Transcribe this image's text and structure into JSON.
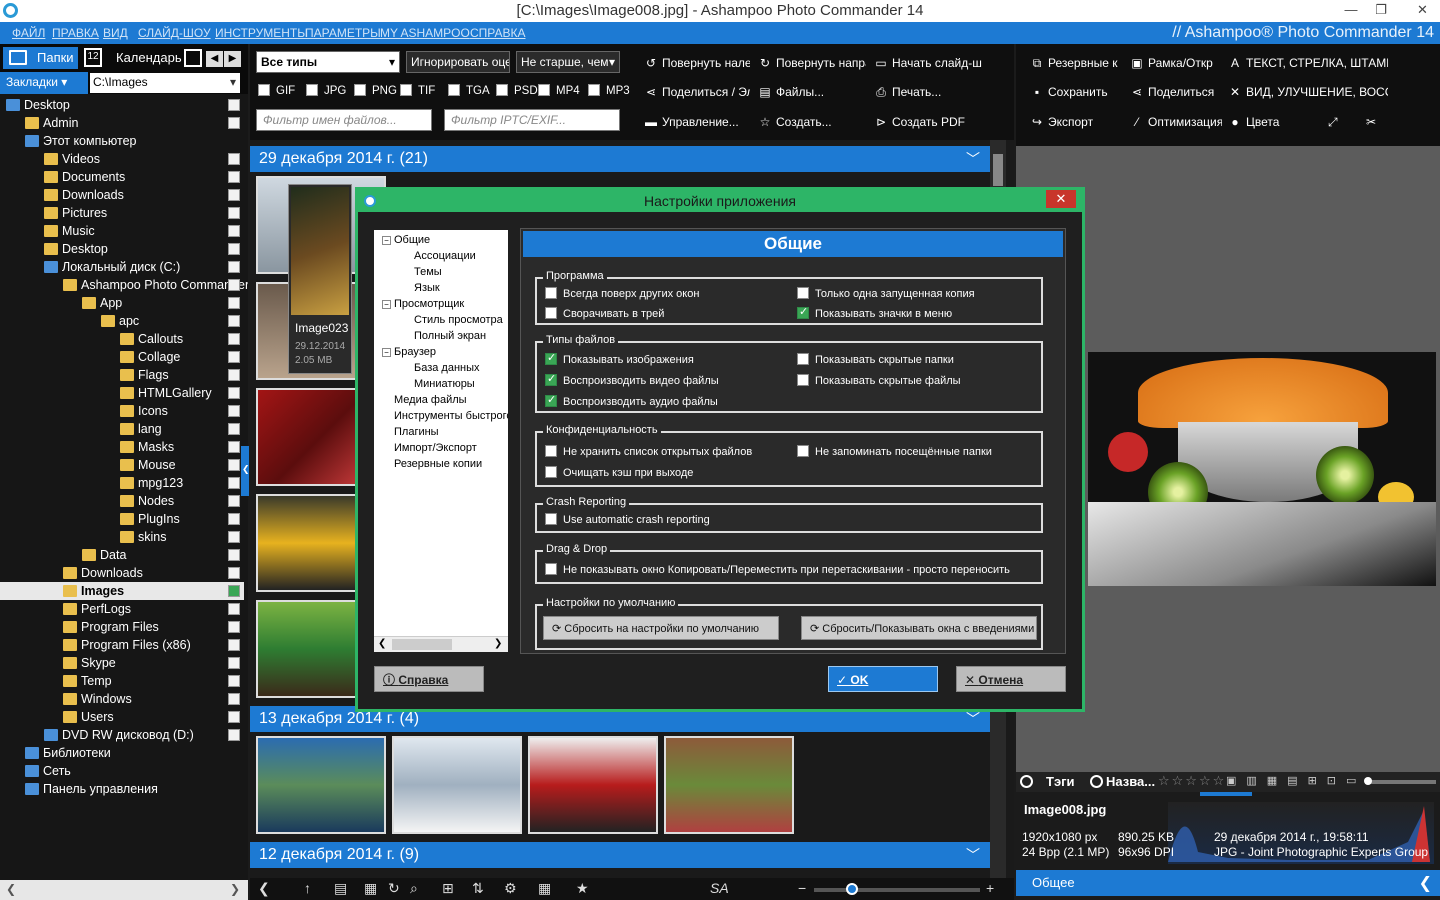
{
  "window": {
    "title": "[C:\\Images\\Image008.jpg] - Ashampoo Photo Commander 14"
  },
  "menu": [
    "ФАЙЛ",
    "ПРАВКА",
    "ВИД",
    "СЛАЙД-ШОУ",
    "ИНСТРУМЕНТЫ",
    "ПАРАМЕТРЫ",
    "MY ASHAMPOO",
    "СПРАВКА"
  ],
  "brand": "// Ashampoo® Photo Commander 14",
  "left": {
    "tabs": {
      "folders": "Папки",
      "calendar": "Календарь"
    },
    "bookmarks": "Закладки",
    "path": "C:\\Images",
    "tree": [
      {
        "label": "Desktop",
        "indent": 0
      },
      {
        "label": "Admin",
        "indent": 1
      },
      {
        "label": "Этот компьютер",
        "indent": 1
      },
      {
        "label": "Videos",
        "indent": 2
      },
      {
        "label": "Documents",
        "indent": 2
      },
      {
        "label": "Downloads",
        "indent": 2
      },
      {
        "label": "Pictures",
        "indent": 2
      },
      {
        "label": "Music",
        "indent": 2
      },
      {
        "label": "Desktop",
        "indent": 2
      },
      {
        "label": "Локальный диск (C:)",
        "indent": 2
      },
      {
        "label": "Ashampoo Photo Commander 14",
        "indent": 3
      },
      {
        "label": "App",
        "indent": 4
      },
      {
        "label": "apc",
        "indent": 5
      },
      {
        "label": "Callouts",
        "indent": 6
      },
      {
        "label": "Collage",
        "indent": 6
      },
      {
        "label": "Flags",
        "indent": 6
      },
      {
        "label": "HTMLGallery",
        "indent": 6
      },
      {
        "label": "Icons",
        "indent": 6
      },
      {
        "label": "lang",
        "indent": 6
      },
      {
        "label": "Masks",
        "indent": 6
      },
      {
        "label": "Mouse",
        "indent": 6
      },
      {
        "label": "mpg123",
        "indent": 6
      },
      {
        "label": "Nodes",
        "indent": 6
      },
      {
        "label": "PlugIns",
        "indent": 6
      },
      {
        "label": "skins",
        "indent": 6
      },
      {
        "label": "Data",
        "indent": 4
      },
      {
        "label": "Downloads",
        "indent": 3
      },
      {
        "label": "Images",
        "indent": 3,
        "selected": true
      },
      {
        "label": "PerfLogs",
        "indent": 3
      },
      {
        "label": "Program Files",
        "indent": 3
      },
      {
        "label": "Program Files (x86)",
        "indent": 3
      },
      {
        "label": "Skype",
        "indent": 3
      },
      {
        "label": "Temp",
        "indent": 3
      },
      {
        "label": "Windows",
        "indent": 3
      },
      {
        "label": "Users",
        "indent": 3
      },
      {
        "label": "DVD RW дисковод (D:)",
        "indent": 2
      },
      {
        "label": "Библиотеки",
        "indent": 1
      },
      {
        "label": "Сеть",
        "indent": 1
      },
      {
        "label": "Панель управления",
        "indent": 1
      }
    ]
  },
  "toolbar": {
    "type_filter": "Все типы",
    "ignore_rating": "Игнорировать оцен",
    "age_filter": "Не старше, чем",
    "filetypes": [
      "GIF",
      "JPG",
      "PNG",
      "TIF",
      "TGA",
      "PSD",
      "MP4",
      "MP3"
    ],
    "filename_filter_placeholder": "Фильтр имен файлов...",
    "iptc_filter_placeholder": "Фильтр IPTC/EXIF...",
    "buttons": {
      "rotate_left": "Повернуть нале",
      "rotate_right": "Повернуть напра",
      "slideshow": "Начать слайд-шо",
      "share": "Поделиться / Эл",
      "files": "Файлы...",
      "print": "Печать...",
      "manage": "Управление...",
      "create": "Создать...",
      "create_pdf": "Создать PDF"
    }
  },
  "groups": [
    {
      "label": "29 декабря 2014 г. (21)"
    },
    {
      "label": "13 декабря 2014 г. (4)"
    },
    {
      "label": "12 декабря 2014 г. (9)"
    }
  ],
  "tooltip": {
    "name": "Image023",
    "date": "29.12.2014",
    "size": "2.05 MB"
  },
  "right": {
    "buttons": {
      "backup": "Резервные к",
      "frame": "Рамка/Откр",
      "text": "ТЕКСТ, СТРЕЛКА, ШТАМП,",
      "save": "Сохранить",
      "share": "Поделиться",
      "view": "ВИД, УЛУЧШЕНИЕ, ВОССТ",
      "export": "Экспорт",
      "optimize": "Оптимизация",
      "colors": "Цвета"
    },
    "tabs": {
      "tags": "Тэги",
      "name": "Назва..."
    },
    "info": {
      "filename": "Image008.jpg",
      "dimensions": "1920x1080 px",
      "filesize": "890.25 KB",
      "datetime": "29 декабря 2014 г., 19:58:11",
      "depth": "24 Bpp (2.1 MP)",
      "dpi": "96x96 DPI",
      "format": "JPG - Joint Photographic Experts Group"
    },
    "footer": "Общее"
  },
  "dialog": {
    "title": "Настройки приложения",
    "nav": [
      {
        "label": "Общие",
        "level": 0,
        "exp": "−"
      },
      {
        "label": "Ассоциации",
        "level": 1
      },
      {
        "label": "Темы",
        "level": 1
      },
      {
        "label": "Язык",
        "level": 1
      },
      {
        "label": "Просмотрщик",
        "level": 0,
        "exp": "−"
      },
      {
        "label": "Стиль просмотра",
        "level": 1
      },
      {
        "label": "Полный экран",
        "level": 1
      },
      {
        "label": "Браузер",
        "level": 0,
        "exp": "−"
      },
      {
        "label": "База данных",
        "level": 1
      },
      {
        "label": "Миниатюры",
        "level": 1
      },
      {
        "label": "Медиа файлы",
        "level": 0
      },
      {
        "label": "Инструменты быстрого доступа",
        "level": 0
      },
      {
        "label": "Плагины",
        "level": 0
      },
      {
        "label": "Импорт/Экспорт",
        "level": 0
      },
      {
        "label": "Резервные копии",
        "level": 0
      }
    ],
    "header": "Общие",
    "sections": {
      "program": {
        "label": "Программа",
        "always_on_top": {
          "text": "Всегда поверх других окон",
          "checked": false
        },
        "single_instance": {
          "text": "Только одна запущенная копия",
          "checked": false
        },
        "minimize_tray": {
          "text": "Сворачивать в трей",
          "checked": false
        },
        "menu_icons": {
          "text": "Показывать значки в меню",
          "checked": true
        }
      },
      "filetypes": {
        "label": "Типы файлов",
        "show_images": {
          "text": "Показывать изображения",
          "checked": true
        },
        "hidden_folders": {
          "text": "Показывать скрытые папки",
          "checked": false
        },
        "play_video": {
          "text": "Воспроизводить видео файлы",
          "checked": true
        },
        "hidden_files": {
          "text": "Показывать скрытые файлы",
          "checked": false
        },
        "play_audio": {
          "text": "Воспроизводить аудио файлы",
          "checked": true
        }
      },
      "privacy": {
        "label": "Конфиденциальность",
        "no_recent": {
          "text": "Не хранить список открытых файлов",
          "checked": false
        },
        "no_visited": {
          "text": "Не запоминать посещённые папки",
          "checked": false
        },
        "clear_cache": {
          "text": "Очищать кэш при выходе",
          "checked": false
        }
      },
      "crash": {
        "label": "Crash Reporting",
        "auto_report": {
          "text": "Use automatic crash reporting",
          "checked": false
        }
      },
      "dragdrop": {
        "label": "Drag & Drop",
        "no_window": {
          "text": "Не показывать окно Копировать/Переместить при перетаскивании - просто переносить",
          "checked": false
        }
      },
      "defaults": {
        "label": "Настройки по умолчанию",
        "reset": "Сбросить на настройки по умолчанию",
        "reset_intro": "Сбросить/Показывать окна с введениями"
      }
    },
    "help": "Справка",
    "ok": "OK",
    "cancel": "Отмена"
  },
  "colors": {
    "accent": "#1d7ad3",
    "dialog_border": "#2db567",
    "close": "#c8352b"
  }
}
